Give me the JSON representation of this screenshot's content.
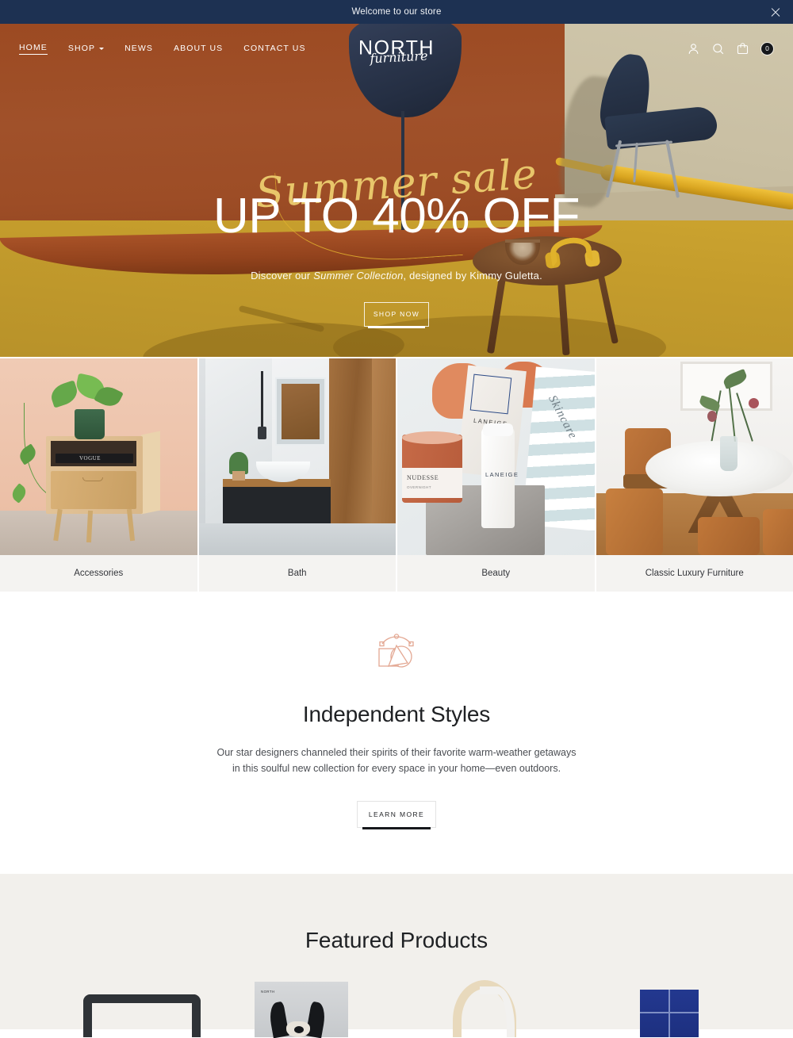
{
  "announcement": {
    "text": "Welcome to our store",
    "close_icon": "close-icon",
    "background": "#1d3152"
  },
  "header": {
    "nav": [
      {
        "label": "HOME",
        "active": true,
        "has_dropdown": false
      },
      {
        "label": "SHOP",
        "active": false,
        "has_dropdown": true
      },
      {
        "label": "NEWS",
        "active": false,
        "has_dropdown": false
      },
      {
        "label": "ABOUT US",
        "active": false,
        "has_dropdown": false
      },
      {
        "label": "CONTACT US",
        "active": false,
        "has_dropdown": false
      }
    ],
    "logo": {
      "primary": "NORTH",
      "script": "furniture"
    },
    "icons": [
      {
        "name": "account-icon"
      },
      {
        "name": "search-icon"
      },
      {
        "name": "bag-icon"
      }
    ],
    "cart_count": "0"
  },
  "hero": {
    "script_headline": "Summer sale",
    "headline": "UP TO 40% OFF",
    "subtitle_before": "Discover our ",
    "subtitle_emphasis": "Summer Collection",
    "subtitle_after": ", designed by Kimmy Guletta.",
    "cta_label": "SHOP NOW",
    "script_color": "#e8c66a"
  },
  "categories": [
    {
      "label": "Accessories"
    },
    {
      "label": "Bath"
    },
    {
      "label": "Beauty"
    },
    {
      "label": "Classic Luxury Furniture"
    }
  ],
  "styles_section": {
    "icon": "design-tool-icon",
    "icon_color": "#e3a893",
    "title": "Independent Styles",
    "body_line1": "Our star designers channeled their spirits of their favorite warm-weather getaways",
    "body_line2": "in this soulful new collection for every space in your home—even outdoors.",
    "cta_label": "LEARN MORE"
  },
  "featured": {
    "title": "Featured Products",
    "background": "#f2f0ec",
    "products": [
      {
        "name": "black-side-table"
      },
      {
        "name": "dog-poster"
      },
      {
        "name": "cream-curved-lamp"
      },
      {
        "name": "blue-panel-art"
      }
    ]
  },
  "tile_art": {
    "accessories": {
      "book_label": "VOGUE"
    },
    "beauty": {
      "candle_brand": "NUDESSE",
      "candle_sub": "OVERNIGHT",
      "box_brand": "LANEIGE",
      "bottle_brand": "LANEIGE",
      "book_word": "Skincare"
    }
  }
}
